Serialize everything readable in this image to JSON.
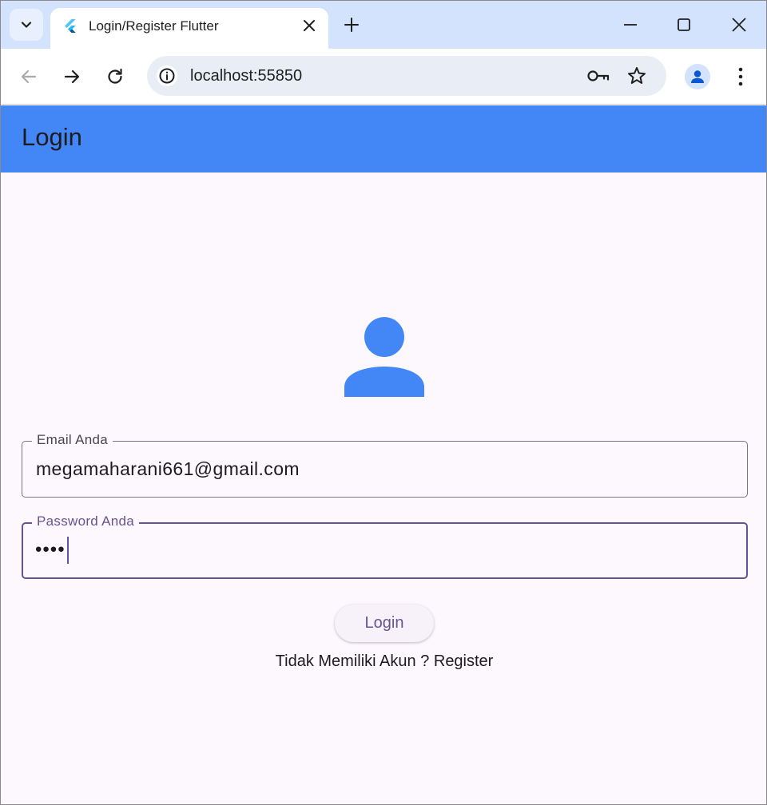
{
  "browser": {
    "tab_title": "Login/Register Flutter",
    "url": "localhost:55850"
  },
  "app": {
    "appbar_title": "Login",
    "accent_color": "#4287f5",
    "email_field": {
      "label": "Email Anda",
      "value": "megamaharani661@gmail.com"
    },
    "password_field": {
      "label": "Password Anda",
      "value": "••••"
    },
    "login_button": "Login",
    "register_link": "Tidak Memiliki Akun ? Register"
  },
  "icons": {
    "tab_search": "chevron-down-icon",
    "favicon": "flutter-logo-icon",
    "tab_close": "close-icon",
    "new_tab": "plus-icon",
    "minimize": "minimize-icon",
    "maximize": "maximize-icon",
    "close_window": "close-icon",
    "back": "arrow-left-icon",
    "forward": "arrow-right-icon",
    "reload": "reload-icon",
    "site_info": "info-icon",
    "password_key": "key-icon",
    "bookmark": "star-icon",
    "profile": "person-icon",
    "menu": "kebab-menu-icon",
    "avatar": "person-icon"
  }
}
